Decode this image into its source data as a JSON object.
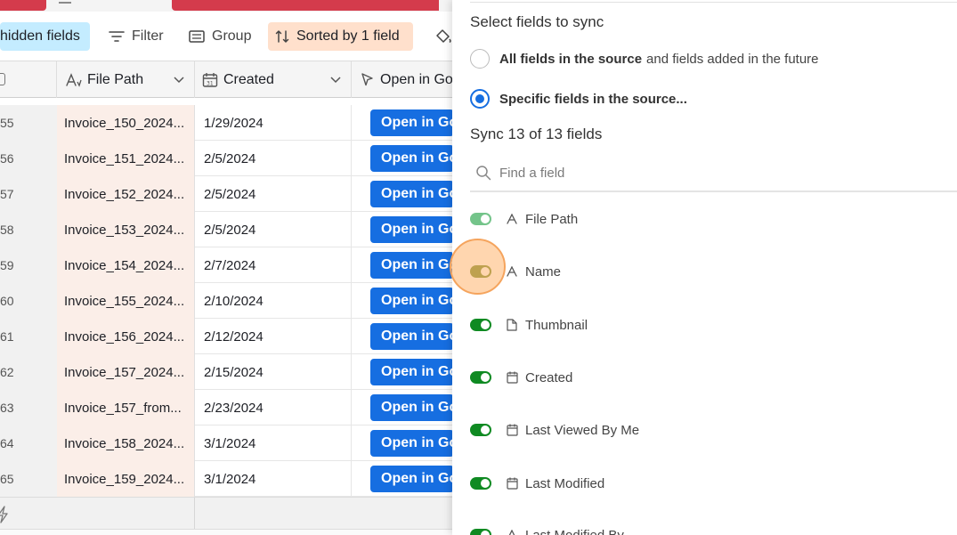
{
  "toolbar": {
    "hidden_fields": "hidden fields",
    "filter": "Filter",
    "group": "Group",
    "sorted": "Sorted by 1 field"
  },
  "grid": {
    "headers": {
      "file_path": "File Path",
      "created": "Created",
      "open": "Open in Go"
    },
    "rows": [
      {
        "idx": "55",
        "file_path": "Invoice_150_2024...",
        "created": "1/29/2024",
        "button": "Open in Go"
      },
      {
        "idx": "56",
        "file_path": "Invoice_151_2024...",
        "created": "2/5/2024",
        "button": "Open in Go"
      },
      {
        "idx": "57",
        "file_path": "Invoice_152_2024...",
        "created": "2/5/2024",
        "button": "Open in Go"
      },
      {
        "idx": "58",
        "file_path": "Invoice_153_2024...",
        "created": "2/5/2024",
        "button": "Open in Go"
      },
      {
        "idx": "59",
        "file_path": "Invoice_154_2024...",
        "created": "2/7/2024",
        "button": "Open in Go"
      },
      {
        "idx": "60",
        "file_path": "Invoice_155_2024...",
        "created": "2/10/2024",
        "button": "Open in Go"
      },
      {
        "idx": "61",
        "file_path": "Invoice_156_2024...",
        "created": "2/12/2024",
        "button": "Open in Go"
      },
      {
        "idx": "62",
        "file_path": "Invoice_157_2024...",
        "created": "2/15/2024",
        "button": "Open in Go"
      },
      {
        "idx": "63",
        "file_path": "Invoice_157_from...",
        "created": "2/23/2024",
        "button": "Open in Go"
      },
      {
        "idx": "64",
        "file_path": "Invoice_158_2024...",
        "created": "3/1/2024",
        "button": "Open in Go"
      },
      {
        "idx": "65",
        "file_path": "Invoice_159_2024...",
        "created": "3/1/2024",
        "button": "Open in Go"
      }
    ]
  },
  "panel": {
    "title": "Select fields to sync",
    "radio_all_bold": "All fields in the source",
    "radio_all_rest": "and fields added in the future",
    "radio_specific": "Specific fields in the source...",
    "sync_count": "Sync 13 of 13 fields",
    "search_placeholder": "Find a field",
    "fields": [
      {
        "label": "File Path",
        "icon": "text-icon",
        "toggle": "light"
      },
      {
        "label": "Name",
        "icon": "text-icon",
        "toggle": "disabled"
      },
      {
        "label": "Thumbnail",
        "icon": "file-icon",
        "toggle": "on"
      },
      {
        "label": "Created",
        "icon": "calendar-icon",
        "toggle": "on"
      },
      {
        "label": "Last Viewed By Me",
        "icon": "calendar-icon",
        "toggle": "on"
      },
      {
        "label": "Last Modified",
        "icon": "calendar-icon",
        "toggle": "on"
      },
      {
        "label": "Last Modified By",
        "icon": "text-icon",
        "toggle": "on"
      }
    ]
  },
  "colors": {
    "accent_blue": "#166ee1",
    "toggle_green": "#0f8a22",
    "sorted_bg": "#ffe0cc",
    "hidden_bg": "#c4ecff",
    "tab_red": "#d43b4c"
  }
}
